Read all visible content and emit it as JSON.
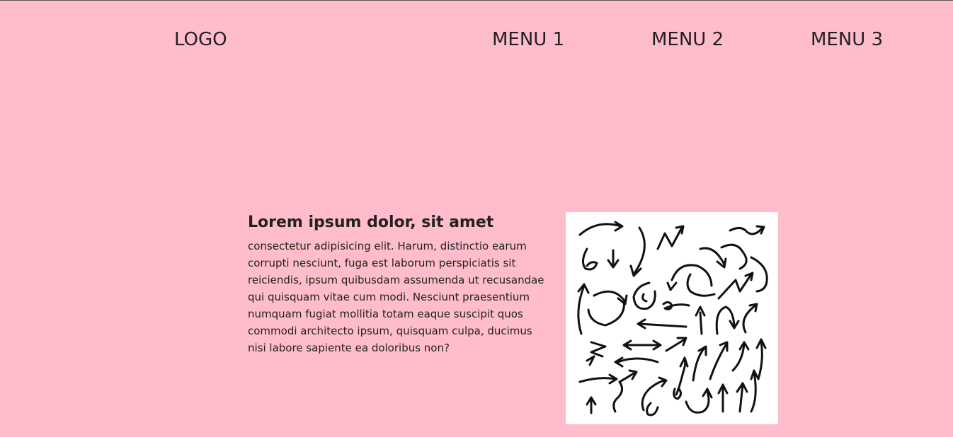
{
  "nav": {
    "logo": "LOGO",
    "menu": [
      "MENU 1",
      "MENU 2",
      "MENU 3"
    ]
  },
  "hero": {
    "heading": "Lorem ipsum dolor, sit amet",
    "body": "consectetur adipisicing elit. Harum, distinctio earum corrupti nesciunt, fuga est laborum perspiciatis sit reiciendis, ipsum quibusdam assumenda ut recusandae qui quisquam vitae cum modi. Nesciunt praesentium numquam fugiat mollitia totam eaque suscipit quos commodi architecto ipsum, quisquam culpa, ducimus nisi labore sapiente ea doloribus non?",
    "image": "hand-drawn-arrows-illustration"
  },
  "colors": {
    "background": "#ffbccb",
    "text": "#222222",
    "image_bg": "#ffffff"
  }
}
